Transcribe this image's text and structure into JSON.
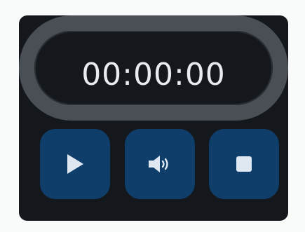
{
  "timer": {
    "display": "00:00:00"
  },
  "controls": {
    "play_icon": "play-icon",
    "volume_icon": "volume-icon",
    "stop_icon": "stop-icon"
  },
  "colors": {
    "background": "#14181d",
    "ring": "#4a4e55",
    "button": "#0f3e6b",
    "icon": "#dfe8f1",
    "text": "#e9ebee"
  }
}
